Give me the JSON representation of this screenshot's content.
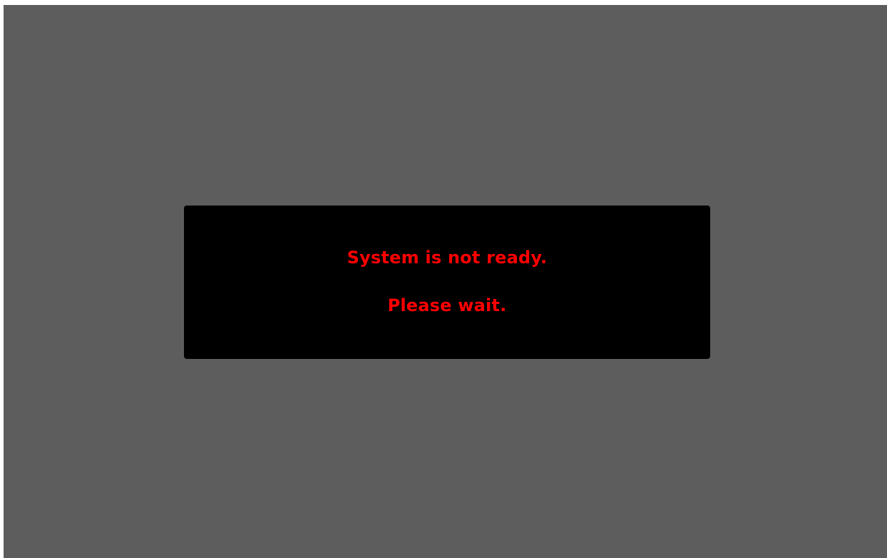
{
  "screen": {
    "background_color": "#5d5d5d"
  },
  "dialog": {
    "background_color": "#000000",
    "text_color": "#ff0000",
    "line1": "System is not ready.",
    "line2": "Please wait."
  }
}
